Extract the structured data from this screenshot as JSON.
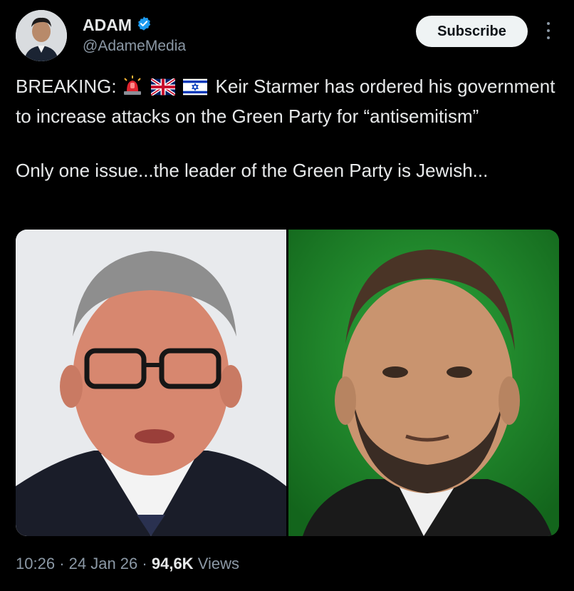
{
  "author": {
    "display_name": "ADAM",
    "handle": "@AdameMedia",
    "verified": true,
    "verified_color": "#1d9bf0",
    "avatar_icon": "profile-photo"
  },
  "header": {
    "subscribe_label": "Subscribe",
    "more_icon": "vertical-ellipsis-icon"
  },
  "tweet": {
    "line1_prefix": "BREAKING:",
    "line1_emojis": [
      "police-light-emoji",
      "uk-flag-emoji",
      "israel-flag-emoji"
    ],
    "line1_suffix": "Keir Starmer has ordered his government to increase attacks on the Green Party for “antisemitism”",
    "line2": "Only one issue...the leader of the Green Party is Jewish..."
  },
  "media": {
    "left_image": "photo-man-with-glasses-light-background",
    "right_image": "photo-bearded-man-green-background",
    "right_bg_color": "#1d8a2a"
  },
  "meta": {
    "time": "10:26",
    "sep1": "·",
    "date": "24 Jan 26",
    "sep2": "·",
    "views_count": "94,6K",
    "views_label": "Views"
  },
  "colors": {
    "background": "#000000",
    "text": "#e7e9ea",
    "secondary": "#8b98a5",
    "button_bg": "#eff3f4"
  }
}
